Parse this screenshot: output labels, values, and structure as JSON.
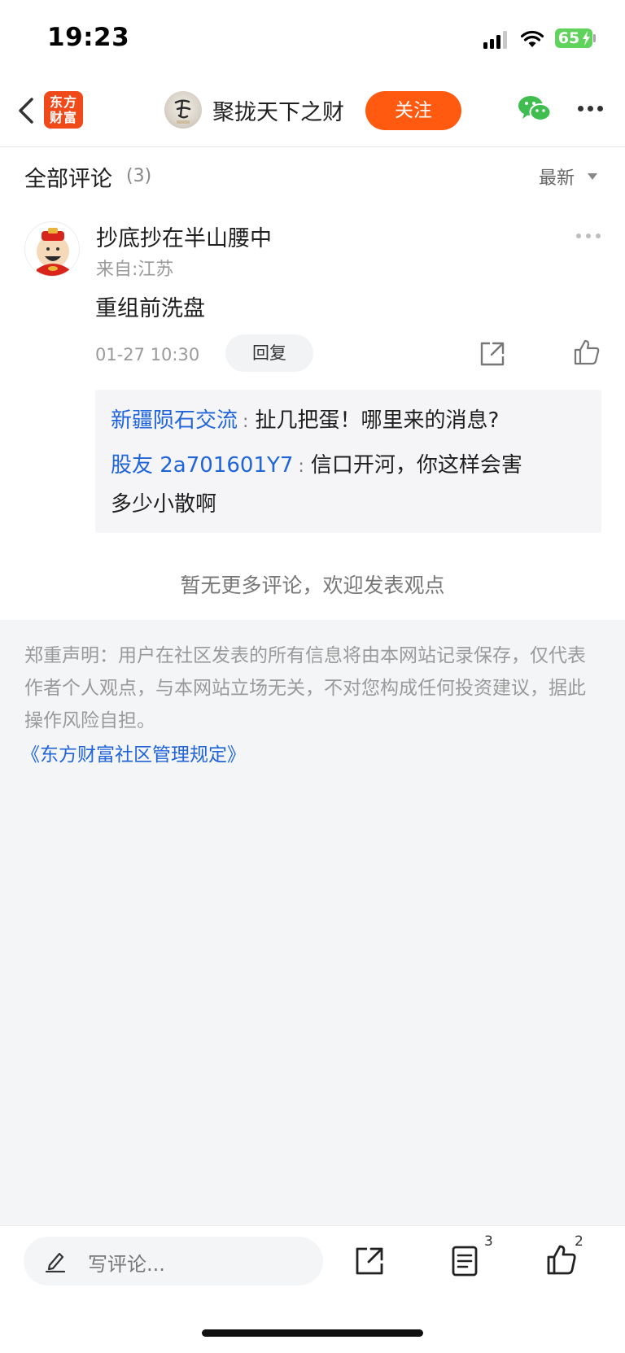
{
  "status_bar": {
    "time": "19:23",
    "battery": "65"
  },
  "header": {
    "logo_line1": "东方",
    "logo_line2": "财富",
    "title": "聚拢天下之财",
    "follow_label": "关注"
  },
  "comments_section": {
    "title": "全部评论",
    "count": "(3)",
    "sort_label": "最新"
  },
  "comment": {
    "author": "抄底抄在半山腰中",
    "location": "来自:江苏",
    "text": "重组前洗盘",
    "time": "01-27 10:30",
    "reply_label": "回复",
    "replies": [
      {
        "user": "新疆陨石交流",
        "separator": ":",
        "text": "扯几把蛋！哪里来的消息?"
      },
      {
        "user": "股友 2a701601Y7",
        "separator": ":",
        "text": "信口开河，你这样会害",
        "text_cont": "多少小散啊"
      }
    ]
  },
  "no_more_text": "暂无更多评论，欢迎发表观点",
  "disclaimer": {
    "text": "郑重声明：用户在社区发表的所有信息将由本网站记录保存，仅代表作者个人观点，与本网站立场无关，不对您构成任何投资建议，据此操作风险自担。",
    "link": "《东方财富社区管理规定》"
  },
  "bottom_bar": {
    "input_placeholder": "写评论...",
    "comments_count": "3",
    "likes_count": "2"
  },
  "colors": {
    "accent": "#ff5a10",
    "link": "#1f64d8",
    "logo_red": "#f04a1a",
    "battery_green": "#5fd35b"
  }
}
